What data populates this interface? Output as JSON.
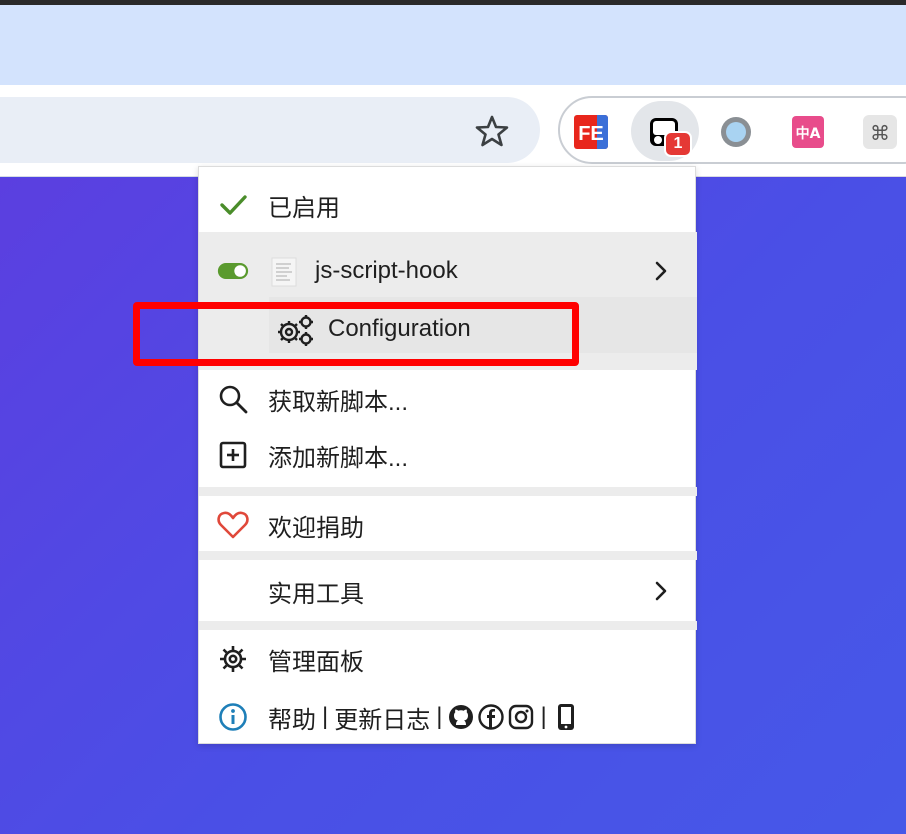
{
  "browser": {
    "extensions": [
      {
        "name": "fe-helper",
        "label": "FE"
      },
      {
        "name": "tampermonkey",
        "badge": "1"
      },
      {
        "name": "circle-extension"
      },
      {
        "name": "translate-extension",
        "label": "中A"
      },
      {
        "name": "command-extension",
        "label": "⌘"
      }
    ]
  },
  "menu": {
    "enabled_label": "已启用",
    "script": {
      "name": "js-script-hook",
      "enabled": true
    },
    "configuration_label": "Configuration",
    "find_scripts_label": "获取新脚本...",
    "add_script_label": "添加新脚本...",
    "donate_label": "欢迎捐助",
    "utilities_label": "实用工具",
    "dashboard_label": "管理面板",
    "help_label": "帮助",
    "changelog_label": "更新日志",
    "divider": "|"
  },
  "colors": {
    "accent_green": "#4a8d2a",
    "toggle_green": "#5a9a2e",
    "heart_red": "#e0483a",
    "info_blue": "#1e7fb8",
    "highlight_red": "#ff0000",
    "badge_red": "#e53935"
  }
}
